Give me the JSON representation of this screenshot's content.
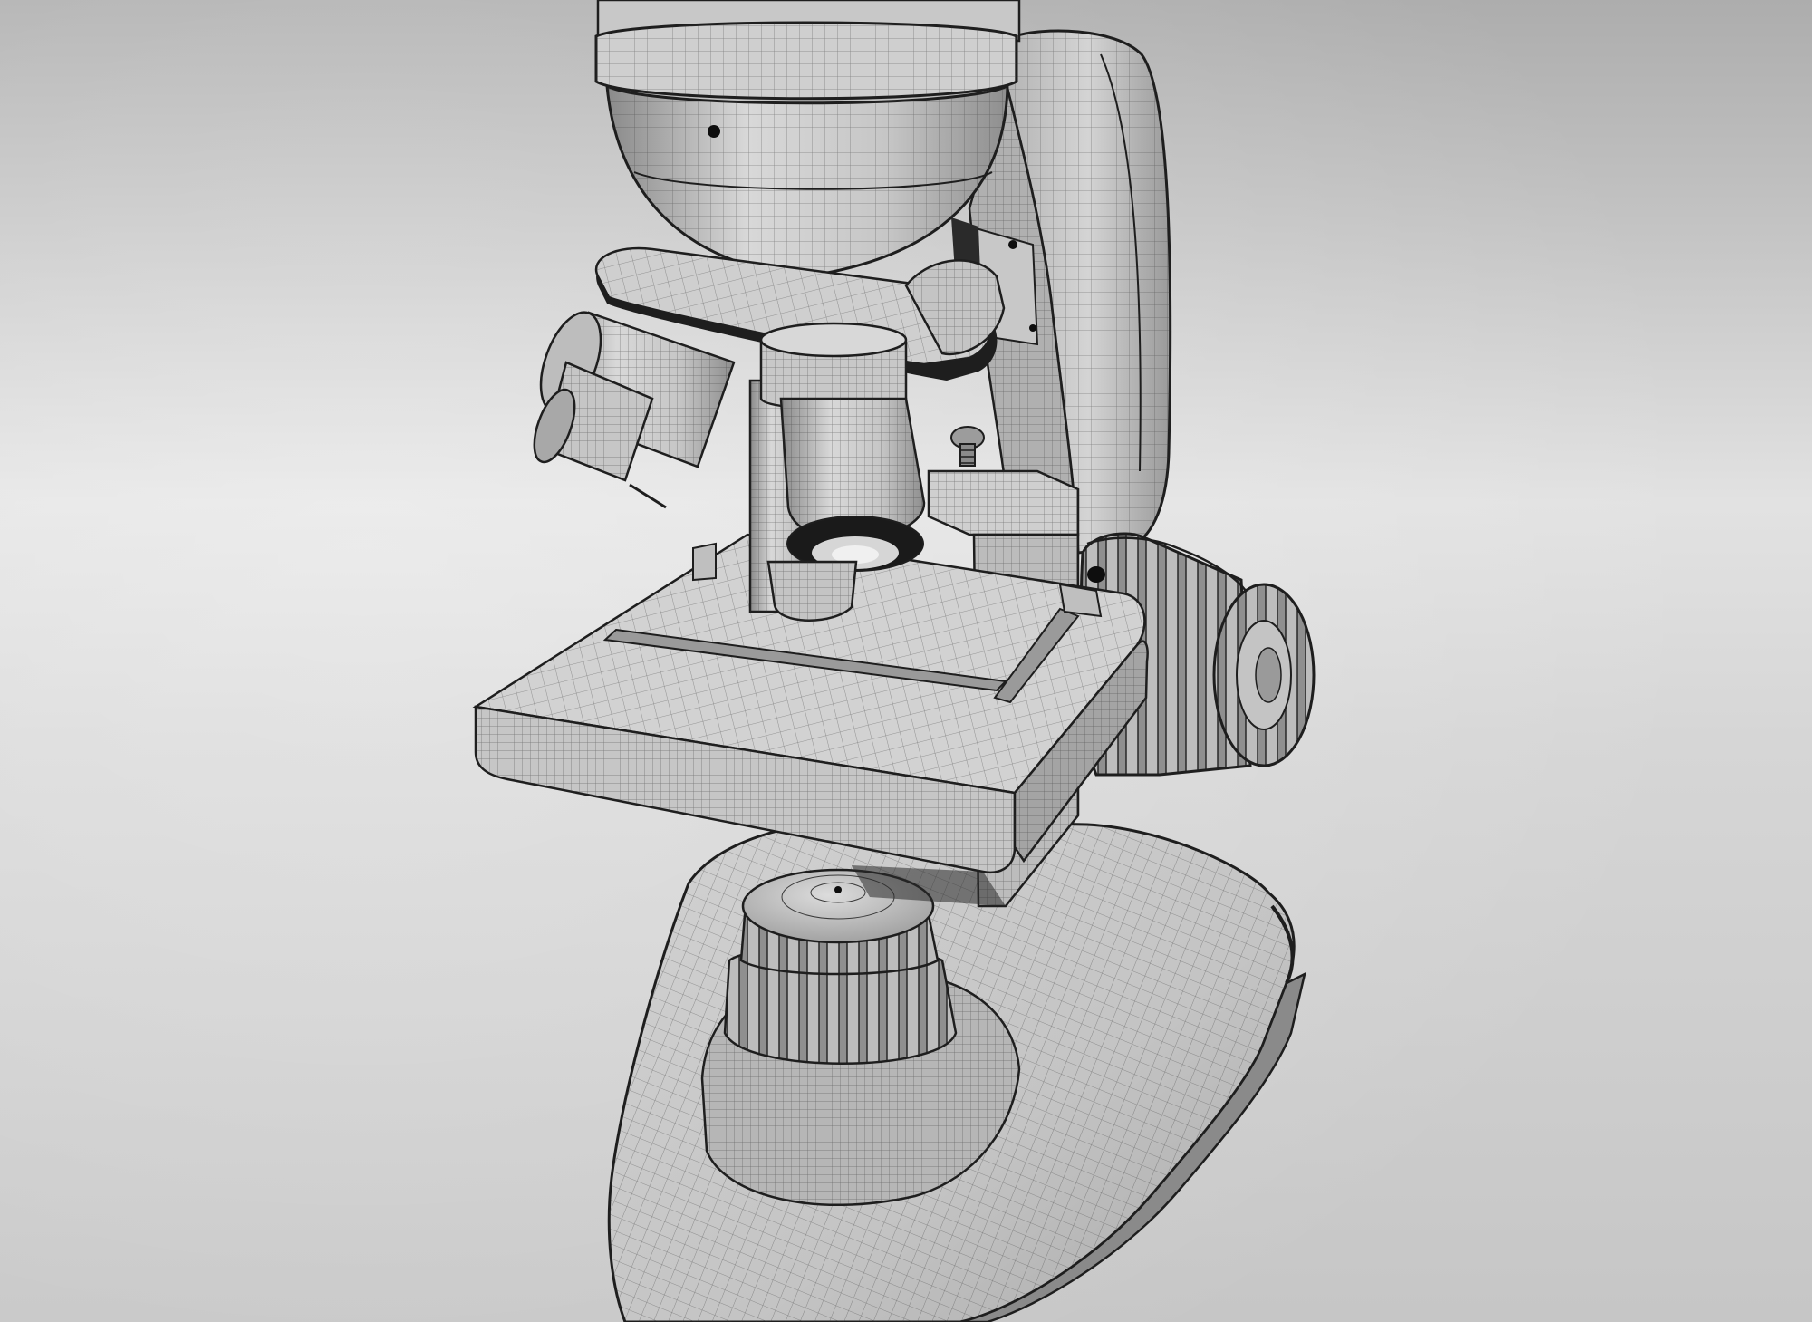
{
  "scene": {
    "subject": "microscope-wireframe-render",
    "colors": {
      "bg_light": "#e6e6e6",
      "bg_mid": "#c8c8c8",
      "bg_dark": "#9d9d9d",
      "surface_light": "#dadada",
      "surface_mid": "#c2c2c2",
      "surface_shade": "#a6a6a6",
      "surface_dark": "#7c7c7c",
      "wire": "#3a3a3a",
      "edge": "#1e1e1e",
      "hole": "#0e0e0e"
    }
  }
}
